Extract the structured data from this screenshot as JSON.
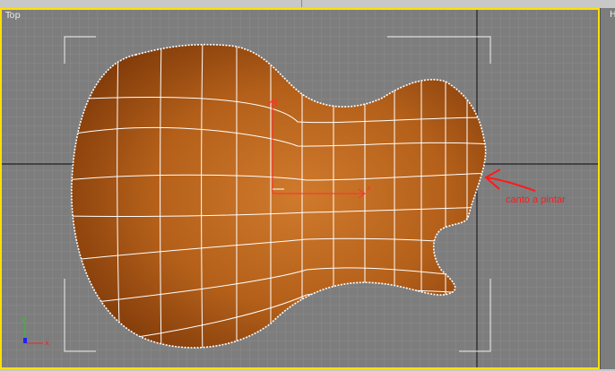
{
  "viewports": {
    "main_label": "Top",
    "side_label": "H"
  },
  "annotation": {
    "text": "canto a pintar",
    "color": "#ff1a1a"
  },
  "gizmo": {
    "x_label": "x",
    "y_label": "y"
  },
  "colors": {
    "viewport_bg": "#7d7d7d",
    "grid_minor": "#8c8c8c",
    "grid_major": "#222222",
    "active_border": "#ffe000",
    "wood_mid": "#b8611a",
    "wood_dark": "#8a3f0c",
    "mesh_lines": "#ffffff",
    "transform_gizmo": "#ff3030"
  }
}
